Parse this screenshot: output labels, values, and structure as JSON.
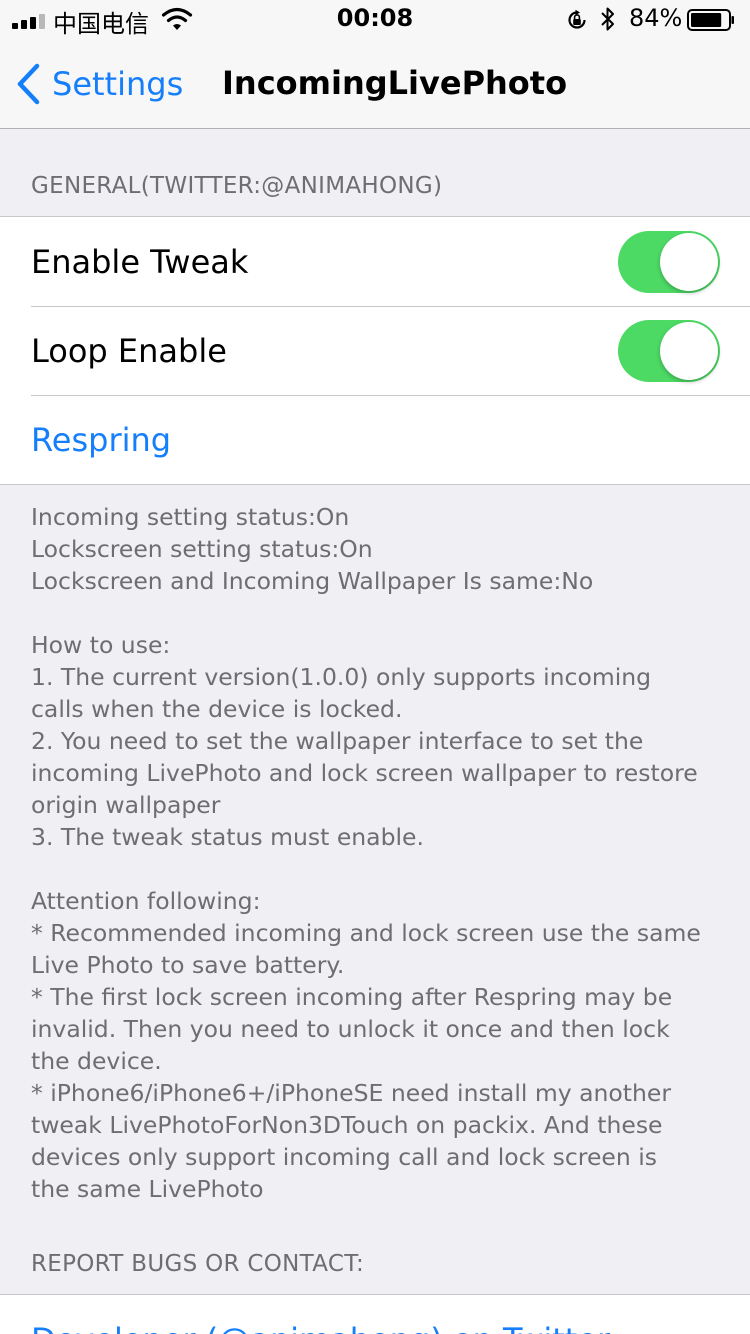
{
  "status_bar": {
    "carrier": "中国电信",
    "time": "00:08",
    "battery": "84%",
    "battery_level": 0.84
  },
  "nav": {
    "back_label": "Settings",
    "title": "IncomingLivePhoto"
  },
  "general": {
    "header": "GENERAL(TWITTER:@ANIMAHONG)",
    "enable_tweak": {
      "label": "Enable Tweak",
      "on": true
    },
    "loop_enable": {
      "label": "Loop Enable",
      "on": true
    },
    "respring_label": "Respring",
    "footer_lines": [
      "Incoming setting status:On",
      "Lockscreen setting status:On",
      "Lockscreen and Incoming Wallpaper Is same:No",
      "",
      "How to use:",
      "1. The current version(1.0.0) only supports incoming",
      "calls when the device is locked.",
      "2. You need to set the wallpaper interface to set the",
      "incoming LivePhoto and lock screen wallpaper to restore",
      "origin wallpaper",
      "3. The tweak status must enable.",
      "",
      "Attention following:",
      "* Recommended incoming and lock screen use the same",
      "Live Photo to save battery.",
      "* The first lock screen incoming after Respring may be",
      "invalid. Then you need to unlock it once and then lock",
      "the device.",
      "* iPhone6/iPhone6+/iPhoneSE need install my another",
      "tweak LivePhotoForNon3DTouch on packix. And these",
      "devices only support incoming call and lock screen is",
      "the same LivePhoto"
    ]
  },
  "report": {
    "header": "REPORT BUGS OR CONTACT:",
    "developer_link": "Developer (@animahong) on Twitter"
  },
  "colors": {
    "accent": "#157efb",
    "toggle_on": "#4cd964",
    "background": "#efeff4",
    "secondary_text": "#6d6d72"
  }
}
